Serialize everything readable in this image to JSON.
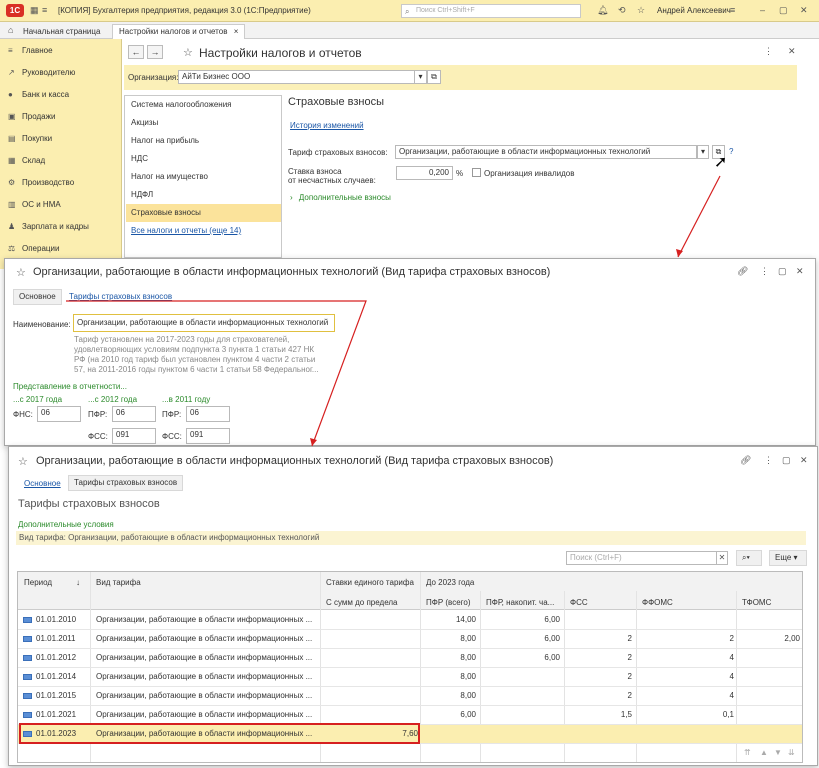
{
  "app": {
    "logo_text": "1С",
    "title": "[КОПИЯ] Бухгалтерия предприятия, редакция 3.0  (1С:Предприятие)",
    "search_placeholder": "Поиск Ctrl+Shift+F",
    "user": "Андрей Алексеевич"
  },
  "tabs": [
    {
      "label": "Начальная страница"
    },
    {
      "label": "Настройки налогов и отчетов",
      "close": "×"
    }
  ],
  "sidebar": {
    "items": [
      {
        "label": "Главное",
        "icon": "menu-icon"
      },
      {
        "label": "Руководителю",
        "icon": "chart-icon"
      },
      {
        "label": "Банк и касса",
        "icon": "coin-icon"
      },
      {
        "label": "Продажи",
        "icon": "cart-icon"
      },
      {
        "label": "Покупки",
        "icon": "bag-icon"
      },
      {
        "label": "Склад",
        "icon": "warehouse-icon"
      },
      {
        "label": "Производство",
        "icon": "factory-icon"
      },
      {
        "label": "ОС и НМА",
        "icon": "building-icon"
      },
      {
        "label": "Зарплата и кадры",
        "icon": "people-icon"
      },
      {
        "label": "Операции",
        "icon": "operations-icon"
      }
    ]
  },
  "settings": {
    "title": "Настройки налогов и отчетов",
    "org_label": "Организация:",
    "org_value": "АйТи Бизнес ООО",
    "list": [
      {
        "label": "Система налогообложения"
      },
      {
        "label": "Акцизы"
      },
      {
        "label": "Налог на прибыль"
      },
      {
        "label": "НДС"
      },
      {
        "label": "Налог на имущество"
      },
      {
        "label": "НДФЛ"
      },
      {
        "label": "Страховые взносы"
      }
    ],
    "all_link": "Все налоги и отчеты (еще 14)",
    "section_title": "Страховые взносы",
    "history_link": "История изменений",
    "tariff_label": "Тариф страховых взносов:",
    "tariff_value": "Организации, работающие в области информационных технологий",
    "rate_label_1": "Ставка взноса",
    "rate_label_2": "от несчастных случаев:",
    "rate_value": "0,200",
    "rate_unit": "%",
    "disabled_org_label": "Организация инвалидов",
    "additional_label": "Дополнительные взносы",
    "help": "?"
  },
  "tariff_card": {
    "title": "Организации, работающие в области информационных технологий (Вид тарифа страховых взносов)",
    "tab_main": "Основное",
    "tab_rates": "Тарифы страховых взносов",
    "name_label": "Наименование:",
    "name_value": "Организации, работающие в области информационных технологий",
    "desc_lines": [
      "Тариф установлен на 2017-2023 годы для страхователей,",
      "удовлетворяющих условиям подпункта 3 пункта 1 статьи 427 НК",
      "РФ (на 2010 год тариф был установлен пунктом 4 части 2 статьи",
      "57, на 2011-2016 годы пунктом 6 части 1 статьи 58 Федеральног..."
    ],
    "reporting_label": "Представление в отчетности...",
    "col_2017": "...с 2017 года",
    "col_2012": "...с 2012 года",
    "col_2011": "...в 2011 году",
    "fns_label": "ФНС:",
    "fns_value": "06",
    "pfr_label": "ПФР:",
    "pfr_2012": "06",
    "pfr_2011": "06",
    "fss_label": "ФСС:",
    "fss_2012": "091",
    "fss_2011": "091"
  },
  "rates_window": {
    "title": "Организации, работающие в области информационных технологий (Вид тарифа страховых взносов)",
    "tab_main": "Основное",
    "tab_rates": "Тарифы страховых взносов",
    "heading": "Тарифы страховых взносов",
    "additional_conditions": "Дополнительные условия",
    "filter_text": "Вид тарифа: Организации, работающие в области информационных технологий",
    "search_placeholder": "Поиск (Ctrl+F)",
    "more_button": "Еще",
    "columns": {
      "period": "Период",
      "sort": "↓",
      "kind": "Вид тарифа",
      "single_rate": "Ставки единого тарифа",
      "within_limit": "С сумм до предела",
      "before_2023": "До 2023 года",
      "pfr_total": "ПФР (всего)",
      "pfr_funded": "ПФР, накопит. ча...",
      "fss": "ФСС",
      "ffoms": "ФФОМС",
      "tfoms": "ТФОМС"
    },
    "rows": [
      {
        "period": "01.01.2010",
        "kind": "Организации, работающие в области информационных ...",
        "single": "",
        "pfr": "14,00",
        "pfr_n": "6,00",
        "fss": "",
        "ffoms": "",
        "tfoms": ""
      },
      {
        "period": "01.01.2011",
        "kind": "Организации, работающие в области информационных ...",
        "single": "",
        "pfr": "8,00",
        "pfr_n": "6,00",
        "fss": "2",
        "ffoms": "2",
        "tfoms": "2,00"
      },
      {
        "period": "01.01.2012",
        "kind": "Организации, работающие в области информационных ...",
        "single": "",
        "pfr": "8,00",
        "pfr_n": "6,00",
        "fss": "2",
        "ffoms": "4",
        "tfoms": ""
      },
      {
        "period": "01.01.2014",
        "kind": "Организации, работающие в области информационных ...",
        "single": "",
        "pfr": "8,00",
        "pfr_n": "",
        "fss": "2",
        "ffoms": "4",
        "tfoms": ""
      },
      {
        "period": "01.01.2015",
        "kind": "Организации, работающие в области информационных ...",
        "single": "",
        "pfr": "8,00",
        "pfr_n": "",
        "fss": "2",
        "ffoms": "4",
        "tfoms": ""
      },
      {
        "period": "01.01.2021",
        "kind": "Организации, работающие в области информационных ...",
        "single": "",
        "pfr": "6,00",
        "pfr_n": "",
        "fss": "1,5",
        "ffoms": "0,1",
        "tfoms": ""
      },
      {
        "period": "01.01.2023",
        "kind": "Организации, работающие в области информационных ...",
        "single": "7,60",
        "pfr": "",
        "pfr_n": "",
        "fss": "",
        "ffoms": "",
        "tfoms": ""
      }
    ]
  },
  "colors": {
    "panel_yellow": "#fbeeb0",
    "selected_row": "#fbe39b",
    "link_blue": "#1a56a6",
    "green_text": "#2a8a2a",
    "highlight_red": "#d62020"
  }
}
